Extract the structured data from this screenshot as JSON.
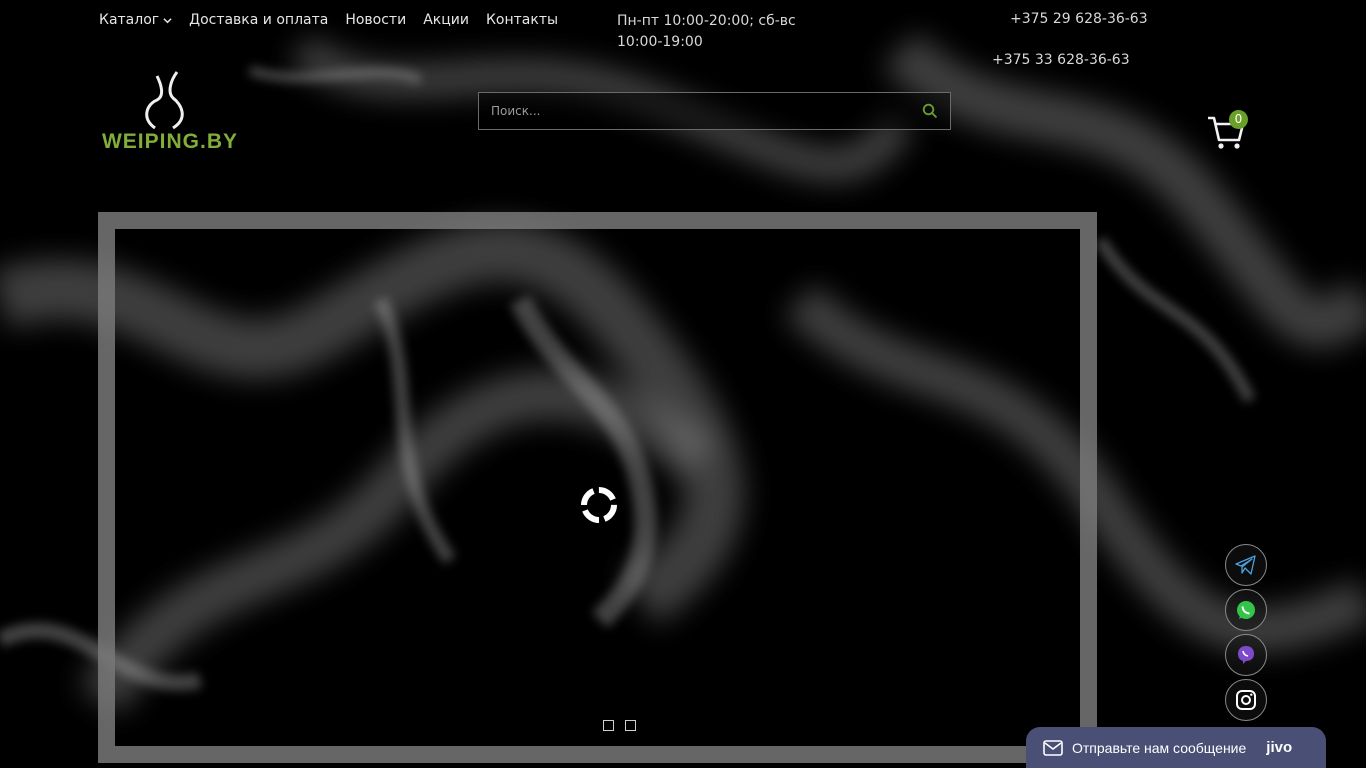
{
  "nav": {
    "catalog": "Каталог",
    "delivery": "Доставка и оплата",
    "news": "Новости",
    "promos": "Акции",
    "contacts": "Контакты"
  },
  "header": {
    "hours": "Пн-пт 10:00-20:00; сб-вс 10:00-19:00",
    "phone1": "+375 29 628-36-63",
    "phone2": "+375 33 628-36-63"
  },
  "logo": {
    "text": "WEIPING.BY"
  },
  "search": {
    "placeholder": "Поиск...",
    "value": ""
  },
  "cart": {
    "count": "0"
  },
  "slider": {
    "slides": 2
  },
  "social": [
    "telegram-icon",
    "whatsapp-icon",
    "viber-icon",
    "instagram-icon"
  ],
  "chat": {
    "message": "Отправьте нам сообщение",
    "brand": "jivo"
  },
  "colors": {
    "accent": "#6aa02a",
    "chat_bg": "#4a4f75",
    "background": "#000000"
  }
}
